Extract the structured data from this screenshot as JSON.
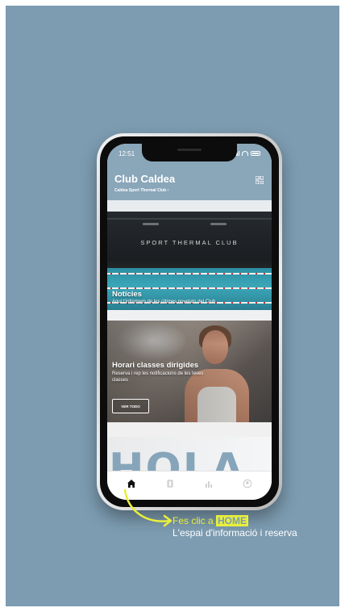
{
  "status": {
    "time": "12:51"
  },
  "header": {
    "title": "Club Caldea",
    "subtitle": "Caldea Sport Thermal Club  ›",
    "qr_icon": "qr-code-icon"
  },
  "cards": {
    "card1": {
      "sign": "SPORT THERMAL CLUB",
      "title": "Notícies",
      "subtitle": "Aquí t'informem de les últimes novetats del Club"
    },
    "card2": {
      "title": "Horari classes dirigides",
      "subtitle": "Reserva i rep les notificacions de les teves classes",
      "button": "VER TODO"
    },
    "card3": {
      "text": "HOLA"
    }
  },
  "tabbar": {
    "items": [
      {
        "icon": "home-icon",
        "active": true
      },
      {
        "icon": "card-icon",
        "active": false
      },
      {
        "icon": "stats-icon",
        "active": false
      },
      {
        "icon": "profile-icon",
        "active": false
      }
    ]
  },
  "annotation": {
    "line1_prefix": "Fes clic a ",
    "line1_highlight": "HOME",
    "line2": "L'espai d'informació i reserva"
  },
  "colors": {
    "background": "#7d9cb1",
    "accent": "#e8ef3a",
    "header": "#8aa6b9"
  }
}
